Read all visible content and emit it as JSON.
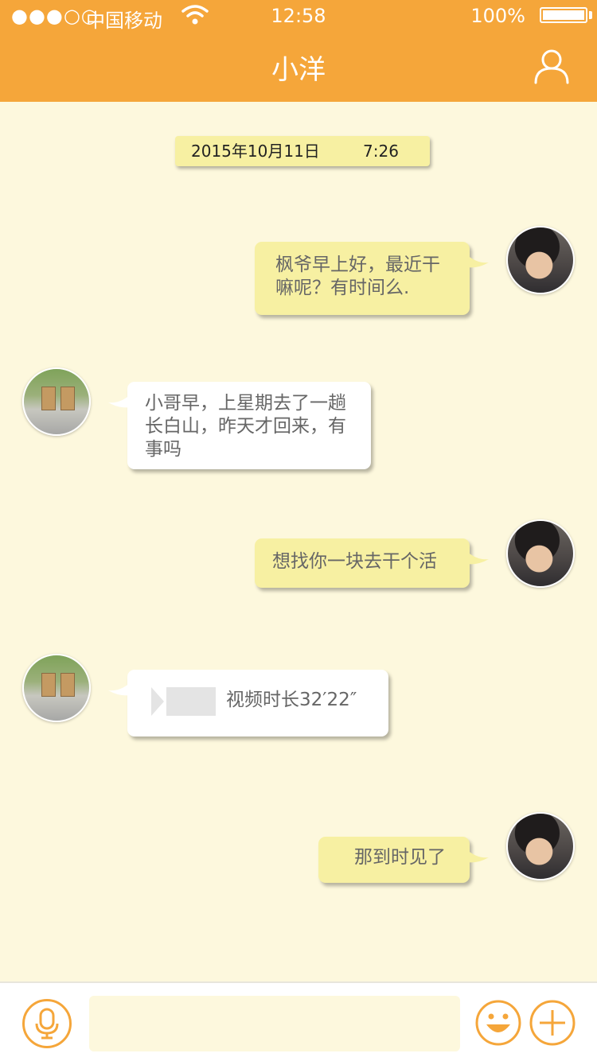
{
  "status_bar": {
    "signal": "●●●○○",
    "carrier": "中国移动",
    "time": "12:58",
    "battery": "100%"
  },
  "header": {
    "title": "小洋",
    "profile_icon": "person-icon"
  },
  "chat": {
    "date_stamp": {
      "date": "2015年10月11日",
      "time": "7:26"
    },
    "messages": [
      {
        "sender": "me",
        "text_line1": "枫爷早上好，最近干",
        "text_line2": "嘛呢？有时间么."
      },
      {
        "sender": "friend",
        "text_line1": "小哥早，上星期去了一趟",
        "text_line2": "长白山，昨天才回来，有",
        "text_line3": "事吗"
      },
      {
        "sender": "me",
        "text": "想找你一块去干个活"
      },
      {
        "sender": "friend",
        "type": "video",
        "text": "视频时长32′22″"
      },
      {
        "sender": "me",
        "text": "那到时见了"
      }
    ]
  },
  "input_bar": {
    "voice_icon": "microphone-icon",
    "input_value": "",
    "input_placeholder": "",
    "emoji_icon": "smiley-icon",
    "add_icon": "plus-icon"
  },
  "colors": {
    "accent": "#f5a63a",
    "background": "#fdf8dd",
    "my_bubble": "#f7f0a2",
    "friend_bubble": "#ffffff"
  }
}
